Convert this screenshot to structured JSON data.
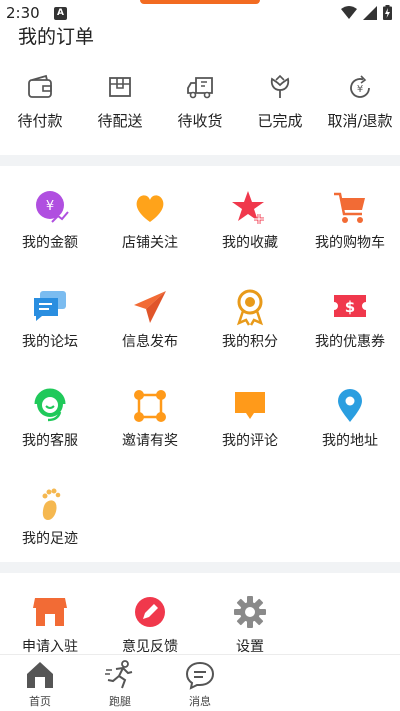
{
  "status_bar": {
    "time": "2:30",
    "notification_letter": "A"
  },
  "orders": {
    "title": "我的订单",
    "items": [
      {
        "label": "待付款",
        "icon": "wallet-icon"
      },
      {
        "label": "待配送",
        "icon": "box-icon"
      },
      {
        "label": "待收货",
        "icon": "truck-icon"
      },
      {
        "label": "已完成",
        "icon": "flower-icon"
      },
      {
        "label": "取消/退款",
        "icon": "refund-icon"
      }
    ]
  },
  "services": [
    {
      "label": "我的金额",
      "icon": "money-icon",
      "color": "#b04fe0"
    },
    {
      "label": "店铺关注",
      "icon": "heart-icon",
      "color": "#ffa31a"
    },
    {
      "label": "我的收藏",
      "icon": "star-plus-icon",
      "color": "#f0384c"
    },
    {
      "label": "我的购物车",
      "icon": "cart-icon",
      "color": "#f26b35"
    },
    {
      "label": "我的论坛",
      "icon": "chat-icon",
      "color": "#2a8ee0"
    },
    {
      "label": "信息发布",
      "icon": "paper-plane-icon",
      "color": "#f26b35"
    },
    {
      "label": "我的积分",
      "icon": "medal-icon",
      "color": "#e89a1a"
    },
    {
      "label": "我的优惠券",
      "icon": "coupon-icon",
      "color": "#f0384c"
    },
    {
      "label": "我的客服",
      "icon": "headset-icon",
      "color": "#20c95a"
    },
    {
      "label": "邀请有奖",
      "icon": "nodes-icon",
      "color": "#ff9a1a"
    },
    {
      "label": "我的评论",
      "icon": "comment-icon",
      "color": "#ff9a1a"
    },
    {
      "label": "我的地址",
      "icon": "location-icon",
      "color": "#2a9ee0"
    },
    {
      "label": "我的足迹",
      "icon": "footprint-icon",
      "color": "#f5b850"
    }
  ],
  "more": [
    {
      "label": "申请入驻",
      "icon": "shop-icon",
      "color": "#f26b35"
    },
    {
      "label": "意见反馈",
      "icon": "pencil-icon",
      "color": "#f0384c"
    },
    {
      "label": "设置",
      "icon": "gear-icon",
      "color": "#8a8a8a"
    }
  ],
  "tabs": [
    {
      "label": "首页",
      "icon": "home-icon"
    },
    {
      "label": "跑腿",
      "icon": "runner-icon"
    },
    {
      "label": "消息",
      "icon": "message-icon"
    }
  ]
}
